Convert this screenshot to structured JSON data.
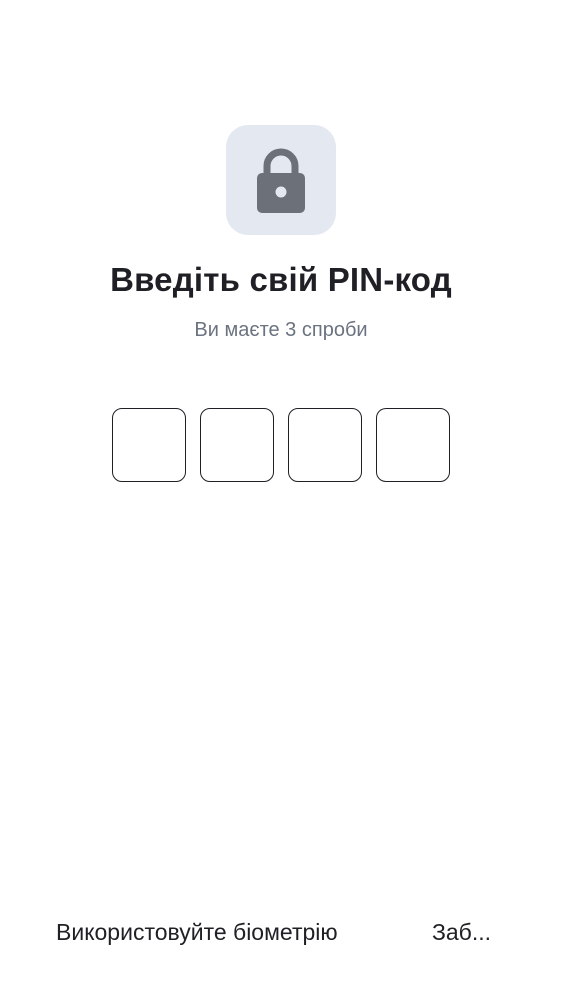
{
  "lock": {
    "icon": "lock-icon",
    "tile_color": "#e4e8f1",
    "icon_color": "#6b7079"
  },
  "title": "Введіть свій PIN-код",
  "subtitle": "Ви маєте 3 спроби",
  "pin": {
    "length": 4,
    "digits": [
      "",
      "",
      "",
      ""
    ]
  },
  "footer": {
    "biometric_label": "Використовуйте біометрію",
    "forgot_label": "Заб..."
  },
  "colors": {
    "text_primary": "#1f2025",
    "text_secondary": "#6b7380",
    "background": "#ffffff"
  }
}
